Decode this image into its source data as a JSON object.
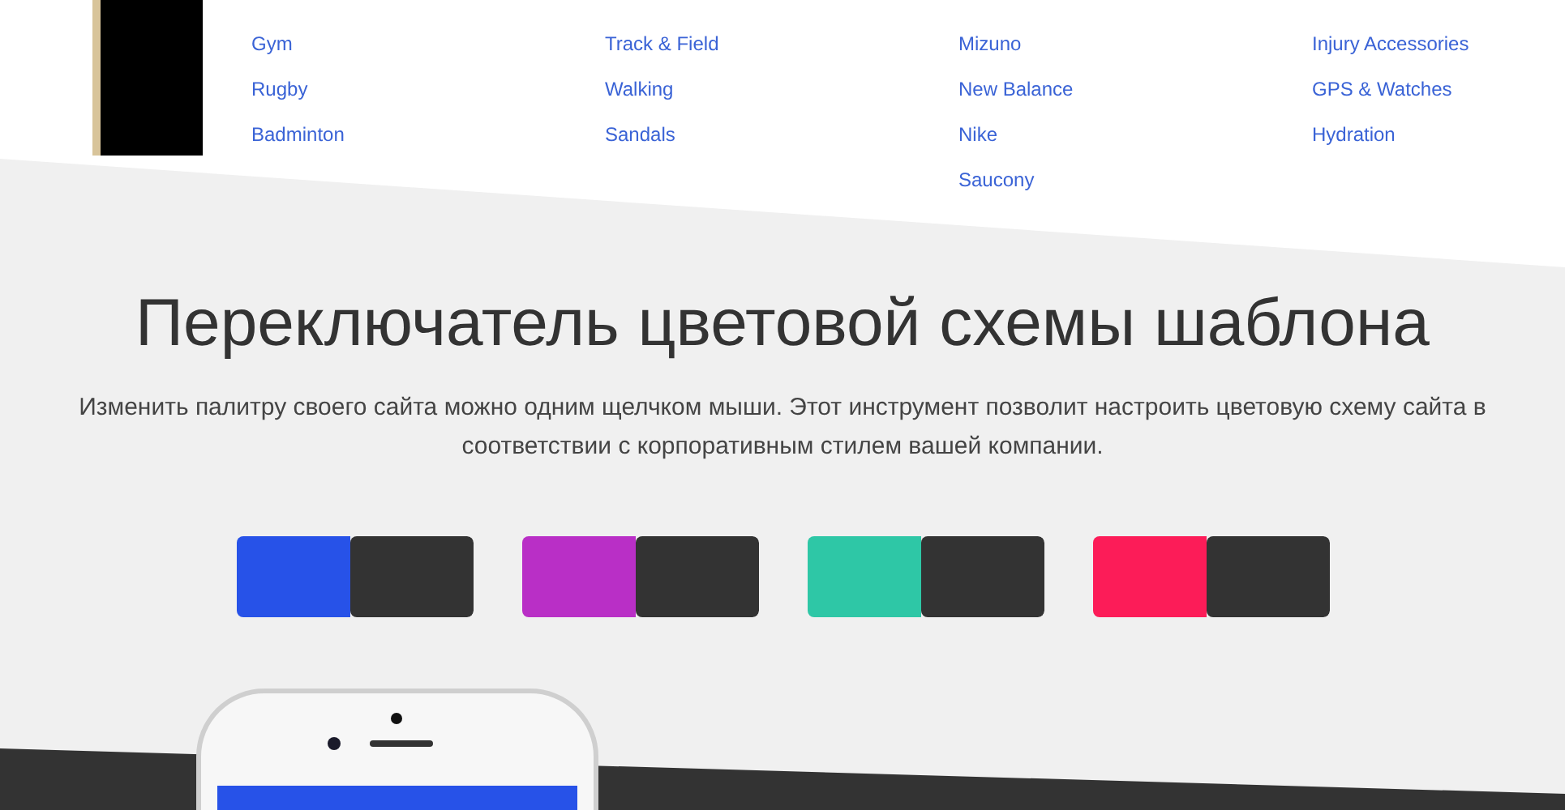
{
  "menu_columns": [
    {
      "links": [
        "Gym",
        "Rugby",
        "Badminton"
      ]
    },
    {
      "links": [
        "Track & Field",
        "Walking",
        "Sandals"
      ]
    },
    {
      "links": [
        "Mizuno",
        "New Balance",
        "Nike",
        "Saucony"
      ]
    },
    {
      "links": [
        "Injury Accessories",
        "GPS & Watches",
        "Hydration"
      ]
    }
  ],
  "heading": "Переключатель цветовой схемы шаблона",
  "description": "Изменить палитру своего сайта можно одним щелчком мыши. Этот инструмент позволит настроить цветовую схему сайта в соответствии с корпоративным стилем вашей компании.",
  "swatches": [
    {
      "color": "#2752e8"
    },
    {
      "color": "#b92fc6"
    },
    {
      "color": "#2ec7a6"
    },
    {
      "color": "#fc1c58"
    }
  ]
}
